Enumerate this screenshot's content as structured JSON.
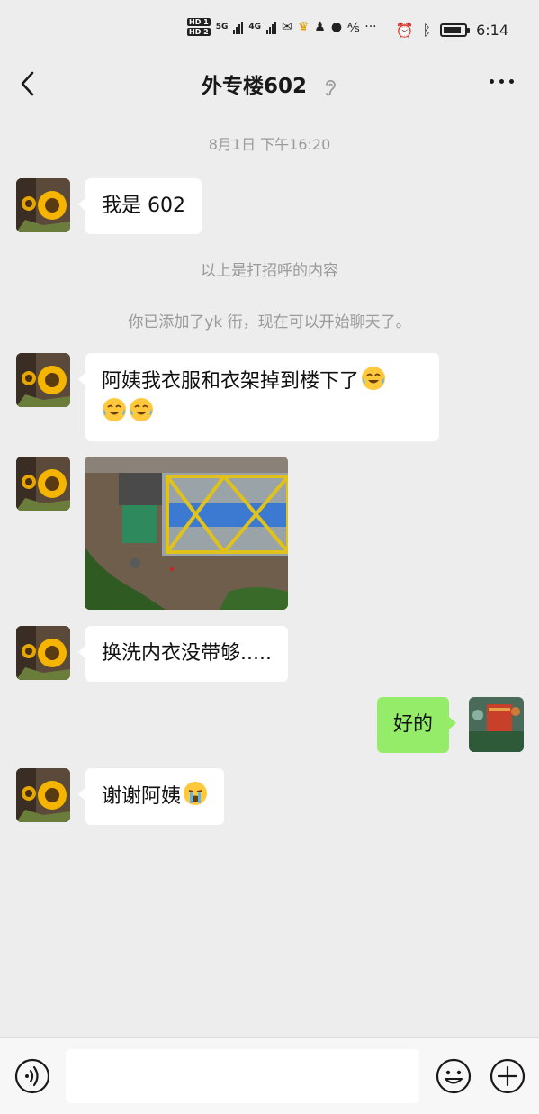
{
  "status_bar": {
    "hd1": "HD 1",
    "hd2": "HD 2",
    "net1": "5G",
    "net2": "4G",
    "time": "6:14",
    "battery_level": 0.85
  },
  "header": {
    "title": "外专楼602"
  },
  "chat": {
    "timestamp": "8月1日 下午16:20",
    "messages": [
      {
        "text": "我是 602"
      },
      {
        "text": "阿姨我衣服和衣架掉到楼下了"
      },
      {
        "text": "换洗内衣没带够....."
      },
      {
        "text": "好的"
      },
      {
        "text": "谢谢阿姨"
      }
    ],
    "system": [
      {
        "text": "以上是打招呼的内容"
      },
      {
        "text": "你已添加了yk 衎，现在可以开始聊天了。"
      }
    ]
  },
  "colors": {
    "background": "#ededed",
    "my_bubble": "#95ec69",
    "their_bubble": "#ffffff",
    "system_text": "#9a9a9a"
  },
  "icons": {
    "back": "chevron-left-icon",
    "mute": "ear-icon",
    "more": "more-icon",
    "voice": "voice-icon",
    "emoji": "smile-icon",
    "plus": "plus-icon"
  }
}
